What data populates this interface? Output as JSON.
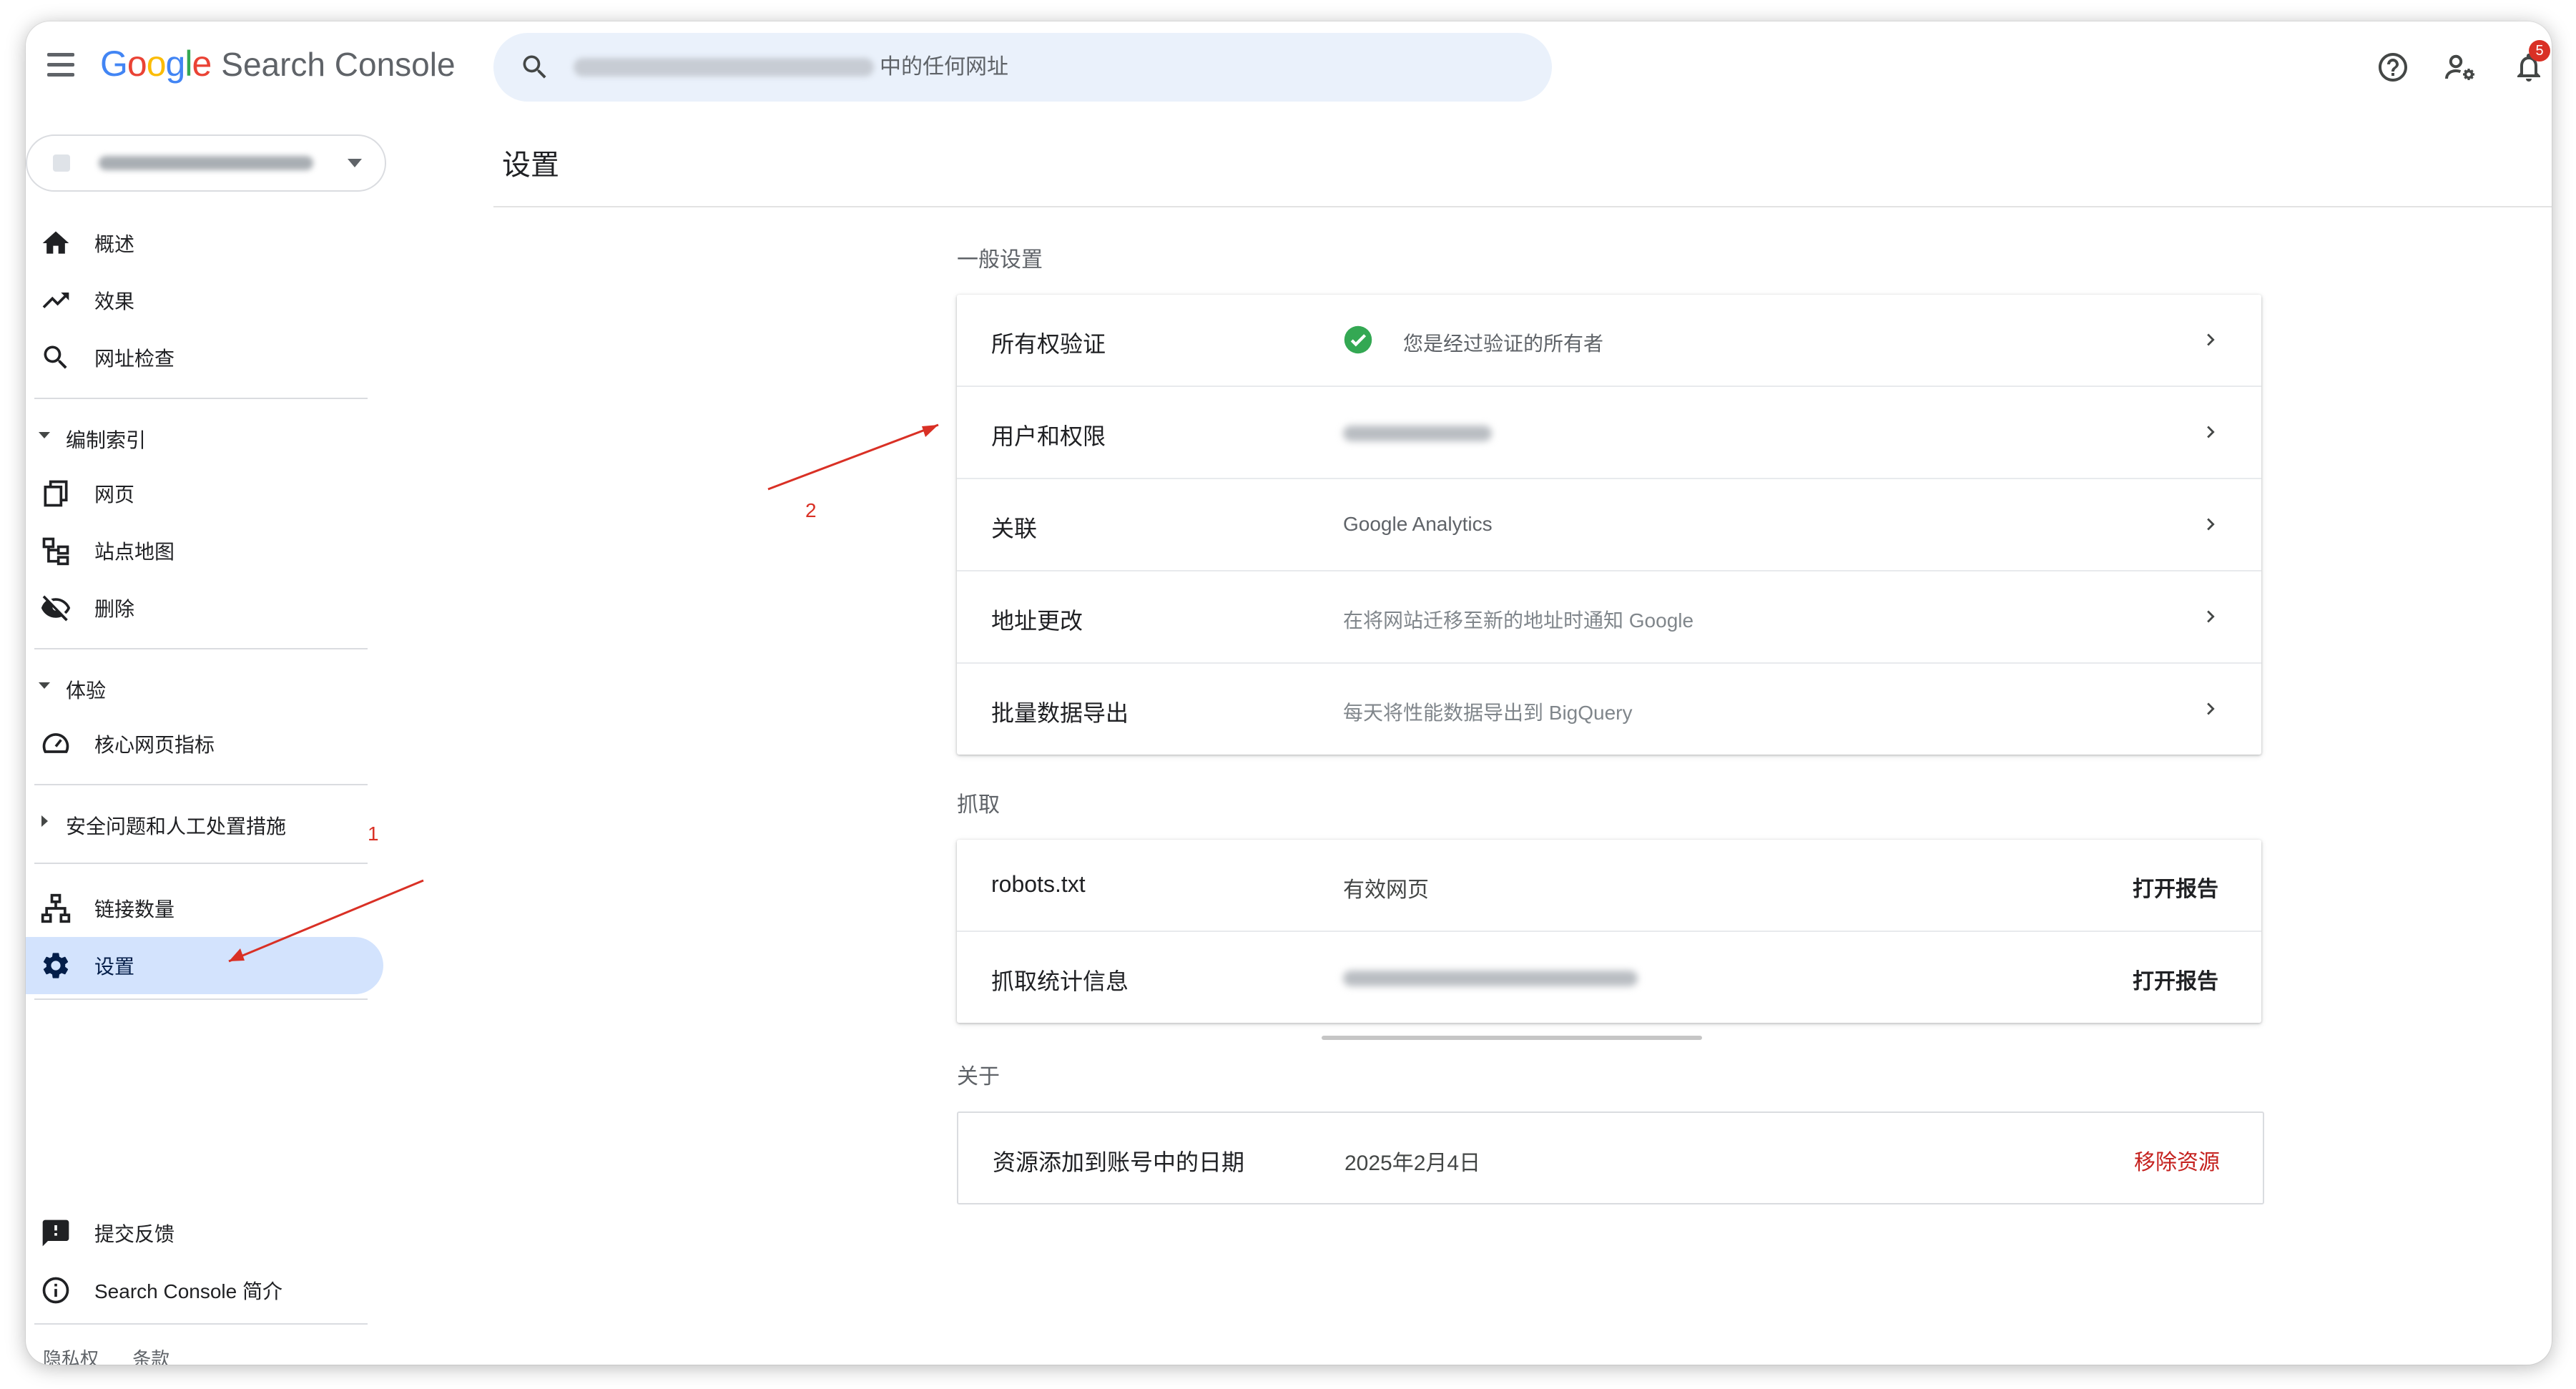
{
  "app": {
    "logo_google": "Google",
    "logo_product": "Search Console",
    "search_placeholder": "中的任何网址",
    "notification_count": "5"
  },
  "sidebar": {
    "items": [
      {
        "label": "概述",
        "icon": "home-icon"
      },
      {
        "label": "效果",
        "icon": "trending-up-icon"
      },
      {
        "label": "网址检查",
        "icon": "search-icon"
      }
    ],
    "section_index": {
      "label": "编制索引",
      "items": [
        {
          "label": "网页",
          "icon": "pages-icon"
        },
        {
          "label": "站点地图",
          "icon": "sitemap-icon"
        },
        {
          "label": "删除",
          "icon": "removals-icon"
        }
      ]
    },
    "section_experience": {
      "label": "体验",
      "items": [
        {
          "label": "核心网页指标",
          "icon": "gauge-icon"
        }
      ]
    },
    "section_security": {
      "label": "安全问题和人工处置措施"
    },
    "links": {
      "label": "链接数量",
      "icon": "links-icon"
    },
    "settings": {
      "label": "设置",
      "icon": "gear-icon"
    },
    "feedback": {
      "label": "提交反馈",
      "icon": "feedback-icon"
    },
    "about": {
      "label": "Search Console 简介",
      "icon": "info-icon"
    },
    "footer": {
      "privacy": "隐私权",
      "terms": "条款"
    }
  },
  "main": {
    "title": "设置",
    "general": {
      "title": "一般设置",
      "rows": [
        {
          "label": "所有权验证",
          "value": "您是经过验证的所有者"
        },
        {
          "label": "用户和权限",
          "value": ""
        },
        {
          "label": "关联",
          "value": "Google Analytics"
        },
        {
          "label": "地址更改",
          "value": "在将网站迁移至新的地址时通知 Google"
        },
        {
          "label": "批量数据导出",
          "value": "每天将性能数据导出到 BigQuery"
        }
      ]
    },
    "crawl": {
      "title": "抓取",
      "rows": [
        {
          "label": "robots.txt",
          "value": "有效网页",
          "action": "打开报告"
        },
        {
          "label": "抓取统计信息",
          "value": "",
          "action": "打开报告"
        }
      ]
    },
    "about": {
      "title": "关于",
      "rows": [
        {
          "label": "资源添加到账号中的日期",
          "value": "2025年2月4日",
          "action": "移除资源"
        }
      ]
    }
  },
  "annotations": {
    "one": "1",
    "two": "2"
  },
  "colors": {
    "accent": "#1a73e8",
    "active_bg": "#d3e3fd",
    "danger": "#c5221f",
    "success": "#34a853",
    "annotation": "#d93025"
  }
}
